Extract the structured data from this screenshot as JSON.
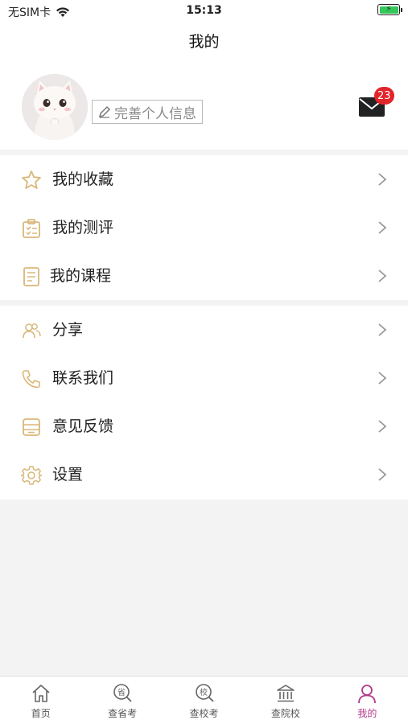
{
  "status": {
    "carrier": "无SIM卡",
    "time": "15:13"
  },
  "nav": {
    "title": "我的"
  },
  "profile": {
    "edit_label": "完善个人信息",
    "mail_badge": "23"
  },
  "menu_group_1": [
    {
      "label": "我的收藏",
      "icon": "star-icon"
    },
    {
      "label": "我的测评",
      "icon": "clipboard-icon"
    },
    {
      "label": "我的课程",
      "icon": "notebook-icon"
    }
  ],
  "menu_group_2": [
    {
      "label": "分享",
      "icon": "people-icon"
    },
    {
      "label": "联系我们",
      "icon": "phone-icon"
    },
    {
      "label": "意见反馈",
      "icon": "feedback-icon"
    },
    {
      "label": "设置",
      "icon": "gear-icon"
    }
  ],
  "tabs": [
    {
      "label": "首页",
      "icon": "home-icon"
    },
    {
      "label": "查省考",
      "icon": "search-province-icon",
      "glyph": "省"
    },
    {
      "label": "查校考",
      "icon": "search-school-icon",
      "glyph": "校"
    },
    {
      "label": "查院校",
      "icon": "institution-icon"
    },
    {
      "label": "我的",
      "icon": "user-icon"
    }
  ],
  "active_tab": "我的",
  "colors": {
    "accent": "#b23a8a",
    "icon_gold": "#d9b87a",
    "badge": "#e1252a",
    "chevron": "#999999"
  }
}
